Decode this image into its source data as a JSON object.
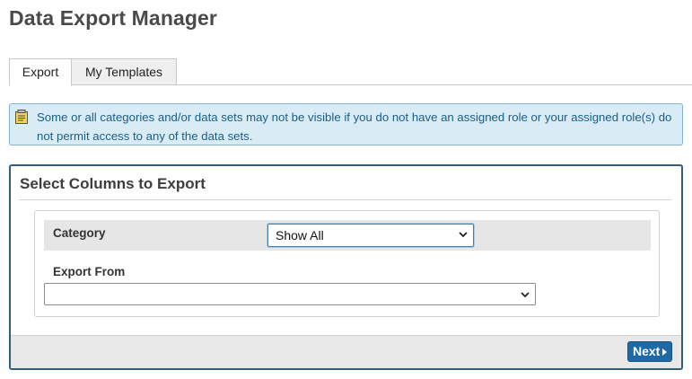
{
  "page": {
    "title": "Data Export Manager"
  },
  "tabs": [
    {
      "label": "Export",
      "active": true
    },
    {
      "label": "My Templates",
      "active": false
    }
  ],
  "info_banner": {
    "icon": "notepad-icon",
    "text": "Some or all categories and/or data sets may not be visible if you do not have an assigned role or your assigned role(s) do not permit access to any of the data sets."
  },
  "panel": {
    "title": "Select Columns to Export",
    "category": {
      "label": "Category",
      "selected": "Show All"
    },
    "export_from": {
      "label": "Export From",
      "selected": ""
    },
    "next_label": "Next"
  },
  "colors": {
    "banner_bg": "#d9ecf6",
    "banner_text": "#1a5e86",
    "panel_border": "#2f5f7a",
    "button_bg": "#1f6aa4"
  }
}
